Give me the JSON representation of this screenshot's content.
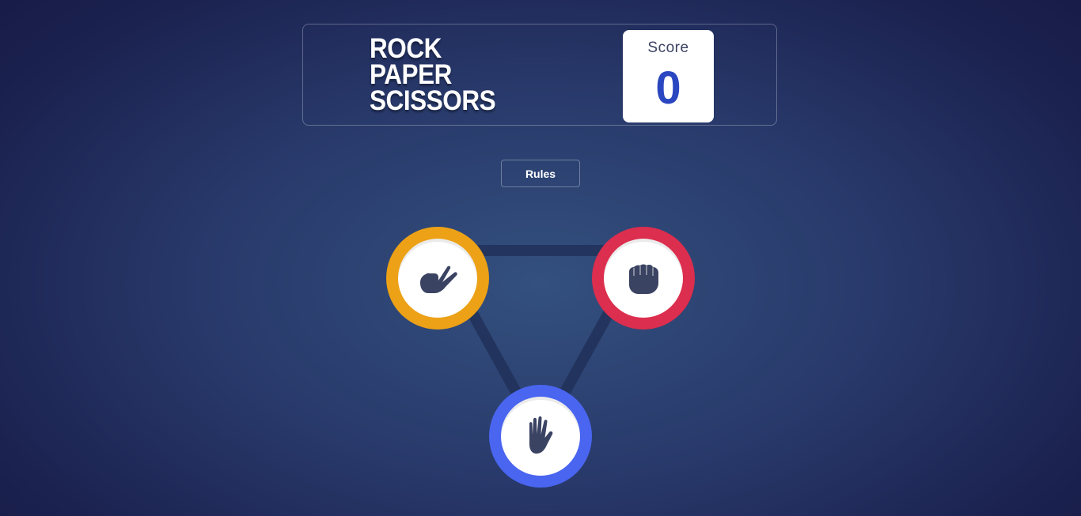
{
  "header": {
    "title_lines": [
      "ROCK",
      "PAPER",
      "SCISSORS"
    ],
    "score_label": "Score",
    "score_value": "0"
  },
  "rules": {
    "label": "Rules"
  },
  "choices": [
    {
      "name": "scissors",
      "icon": "scissors-hand-icon",
      "ring_color": "#eca116"
    },
    {
      "name": "rock",
      "icon": "fist-icon",
      "ring_color": "#dc2e4e"
    },
    {
      "name": "paper",
      "icon": "open-hand-icon",
      "ring_color": "#4a65f0"
    }
  ],
  "colors": {
    "icon": "#3b4363",
    "score_value": "#2a46c0",
    "triangle_line": "#1f2d55"
  }
}
